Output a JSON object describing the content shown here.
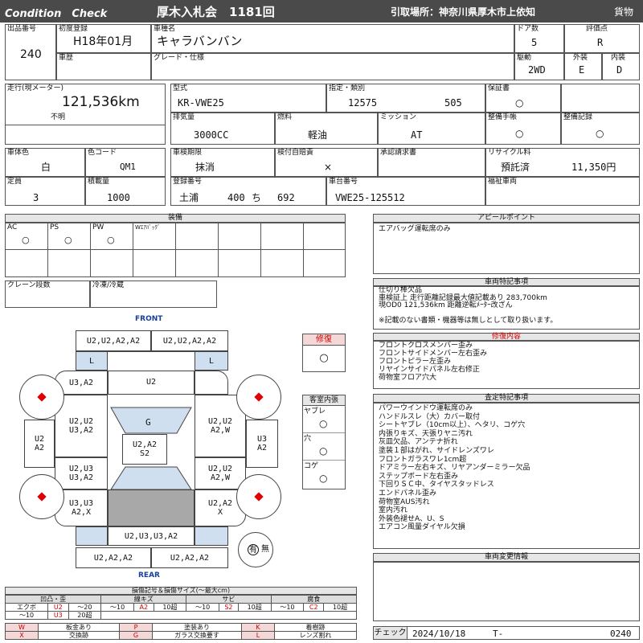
{
  "header": {
    "title_left": "Condition　Check",
    "auction": "厚木入札会　1181回",
    "pickup": "引取場所：神奈川県厚木市上依知",
    "type": "貨物"
  },
  "vehicle": {
    "lot_label": "出品番号",
    "lot": "240",
    "first_reg_label": "初度登録",
    "first_reg": "H18年01月",
    "name_label": "車種名",
    "name": "キャラバンバン",
    "doors_label": "ドア数",
    "doors": "5",
    "score_label": "評価点",
    "score": "R",
    "history_label": "車歴",
    "grade_label": "グレード・仕様",
    "drive_label": "駆動",
    "drive": "2WD",
    "exterior_label": "外装",
    "exterior": "E",
    "interior_label": "内装",
    "interior": "D"
  },
  "specs": {
    "mileage_label": "走行(現メーター)",
    "mileage": "121,536km",
    "mileage_note": "不明",
    "model_label": "型式",
    "model": "KR-VWE25",
    "designation_label": "指定・類別",
    "designation": "12575",
    "category": "505",
    "warranty_label": "保証書",
    "warranty": "○",
    "displacement_label": "排気量",
    "displacement": "3000CC",
    "fuel_label": "燃料",
    "fuel": "軽油",
    "mission_label": "ミッション",
    "mission": "AT",
    "manual_label": "整備手帳",
    "manual": "○",
    "record_label": "整備記録",
    "record": "○",
    "color_label": "車体色",
    "color": "白",
    "color_code_label": "色コード",
    "color_code": "QM1",
    "inspection_label": "車検期限",
    "inspection": "抹消",
    "self_ins_label": "検付自賠責",
    "self_ins": "×",
    "approval_label": "承認請求書",
    "recycle_label": "リサイクル料",
    "recycle_status": "預託済",
    "recycle_fee": "11,350円",
    "capacity_label": "定員",
    "capacity": "3",
    "load_label": "積載量",
    "load": "1000",
    "plate_label": "登録番号",
    "plate_area": "土浦",
    "plate_class": "400",
    "plate_kana": "ち",
    "plate_num": "692",
    "chassis_label": "車台番号",
    "chassis": "VWE25-125512",
    "welfare_label": "福祉車両"
  },
  "equipment": {
    "title": "装備",
    "items": [
      {
        "name": "AC",
        "mark": "○"
      },
      {
        "name": "PS",
        "mark": "○"
      },
      {
        "name": "PW",
        "mark": "○"
      },
      {
        "name": "Wｴｱﾊﾞｯｸﾞ",
        "mark": ""
      }
    ],
    "crane_label": "クレーン段数",
    "freezer_label": "冷凍/冷蔵"
  },
  "appeal": {
    "title": "アピールポイント",
    "text": "エアバッグ運転席のみ"
  },
  "special": {
    "title": "車両特記事項",
    "lines": [
      "仕切り棒欠品",
      "車検証上 走行距離記録最大値記載あり 283,700km",
      "現OD0 121,536km 距離逆転ﾒｰﾀｰ改ざん",
      "",
      "※記載のない書類・機器等は無しとして取り扱います。"
    ]
  },
  "repair": {
    "title": "修復内容",
    "lines": [
      "フロントクロスメンバー歪み",
      "フロントサイドメンバー左右歪み",
      "フロントピラー左歪み",
      "リヤインサイドパネル左右修正",
      "荷物室フロア穴大"
    ]
  },
  "inspection_notes": {
    "title": "査定特記事項",
    "lines": [
      "パワーウインドウ運転席のみ",
      "ハンドルスレ（大）カバー取付",
      "シートヤブレ（10cm以上）、ヘタリ、コゲ穴",
      "内張りキズ、天張りヤニ汚れ",
      "灰皿欠品、アンテナ折れ",
      "塗装１部はがれ、サイドレンズワレ",
      "フロントガラスワレ1cm超",
      "ドアミラー左右キズ、リヤアンダーミラー欠品",
      "ステップボード左右歪み",
      "下回りＳＣ中、タイヤスタッドレス",
      "エンドパネル歪み",
      "荷物室AUS汚れ",
      "室内汚れ",
      "外装色褪せA、U、S",
      "エアコン風量ダイヤル欠損"
    ]
  },
  "change": {
    "title": "車両変更情報"
  },
  "check": {
    "label": "チェック",
    "date": "2024/10/18",
    "t_label": "T-",
    "number": "0240"
  },
  "diagram": {
    "front": "FRONT",
    "rear": "REAR",
    "boxes": {
      "b_fl": "U2,U2,A2,A2",
      "b_fr": "U2,U2,A2,A2",
      "b_l1": "L",
      "b_l2": "L",
      "b_u3a2": "U3,A2",
      "b_u2": "U2",
      "b_g": "G",
      "b_left_u2u2": "U2,U2\nU3,A2",
      "b_right_u2u2": "U2,U2\nA2,W",
      "b_leftmost": "U2\nA2",
      "b_rightmost": "U3\nA2",
      "b_center": "U2,A2\nS2",
      "b_left_u2u3": "U2,U3\nU3,A2",
      "b_right_u2u2b": "U2,U2\nA2,W",
      "b_left_u3u3": "U3,U3\nA2,X",
      "b_right_a2": "U2,A2\nX",
      "b_rear_mid": "U2,U3,U3,A2",
      "b_rl": "U2,A2,A2",
      "b_rr": "U2,A2,A2"
    },
    "spare": "有",
    "spare_none": "無",
    "repair_label": "修復",
    "repair_mark": "○",
    "interior_title": "客室内張",
    "tear_label": "ヤブレ",
    "tear_mark": "○",
    "hole_label": "穴",
    "hole_mark": "○",
    "burn_label": "コゲ",
    "burn_mark": "○"
  },
  "legend": {
    "title": "損傷記号＆損傷サイズ(～最大cm)",
    "groups": [
      {
        "name": "凹凸・歪",
        "row1": [
          "エクボ",
          "U2",
          "～20"
        ],
        "row2": [
          "～10",
          "U3",
          "20超"
        ]
      },
      {
        "name": "線キズ",
        "row1": [
          "～10",
          "A2",
          "10超"
        ],
        "row2": []
      },
      {
        "name": "サビ",
        "row1": [
          "～10",
          "S2",
          "10超"
        ],
        "row2": []
      },
      {
        "name": "腐食",
        "row1": [
          "～10",
          "C2",
          "10超"
        ],
        "row2": []
      }
    ],
    "codes": [
      [
        "W",
        "板金あり",
        "P",
        "塗装あり",
        "K",
        "着樹跡"
      ],
      [
        "X",
        "交換跡",
        "G",
        "ガラス交換要す",
        "L",
        "レンズ割れ"
      ]
    ]
  }
}
